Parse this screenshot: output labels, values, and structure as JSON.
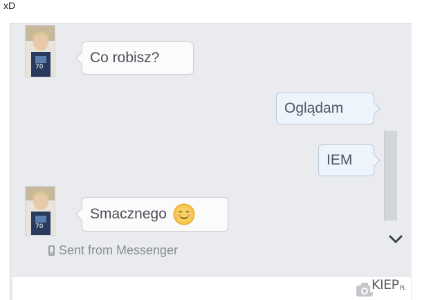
{
  "caption": "xD",
  "messages": [
    {
      "from": "contact",
      "text": "Co robisz?"
    },
    {
      "from": "me",
      "text": "Oglądam"
    },
    {
      "from": "me",
      "text": "IEM"
    },
    {
      "from": "contact",
      "text": "Smacznego",
      "emoji": "smiling-face-icon"
    }
  ],
  "status": {
    "sent_label": "Sent from Messenger",
    "icon": "phone-icon"
  },
  "composer": {
    "icon": "camera-icon"
  },
  "watermark": {
    "main": "KIEP",
    "sub": "PL"
  },
  "colors": {
    "chat_background": "#e9ebee",
    "bubble_incoming": "#fbfbfc",
    "bubble_outgoing": "#eef4fb",
    "text": "#4b4f56"
  }
}
